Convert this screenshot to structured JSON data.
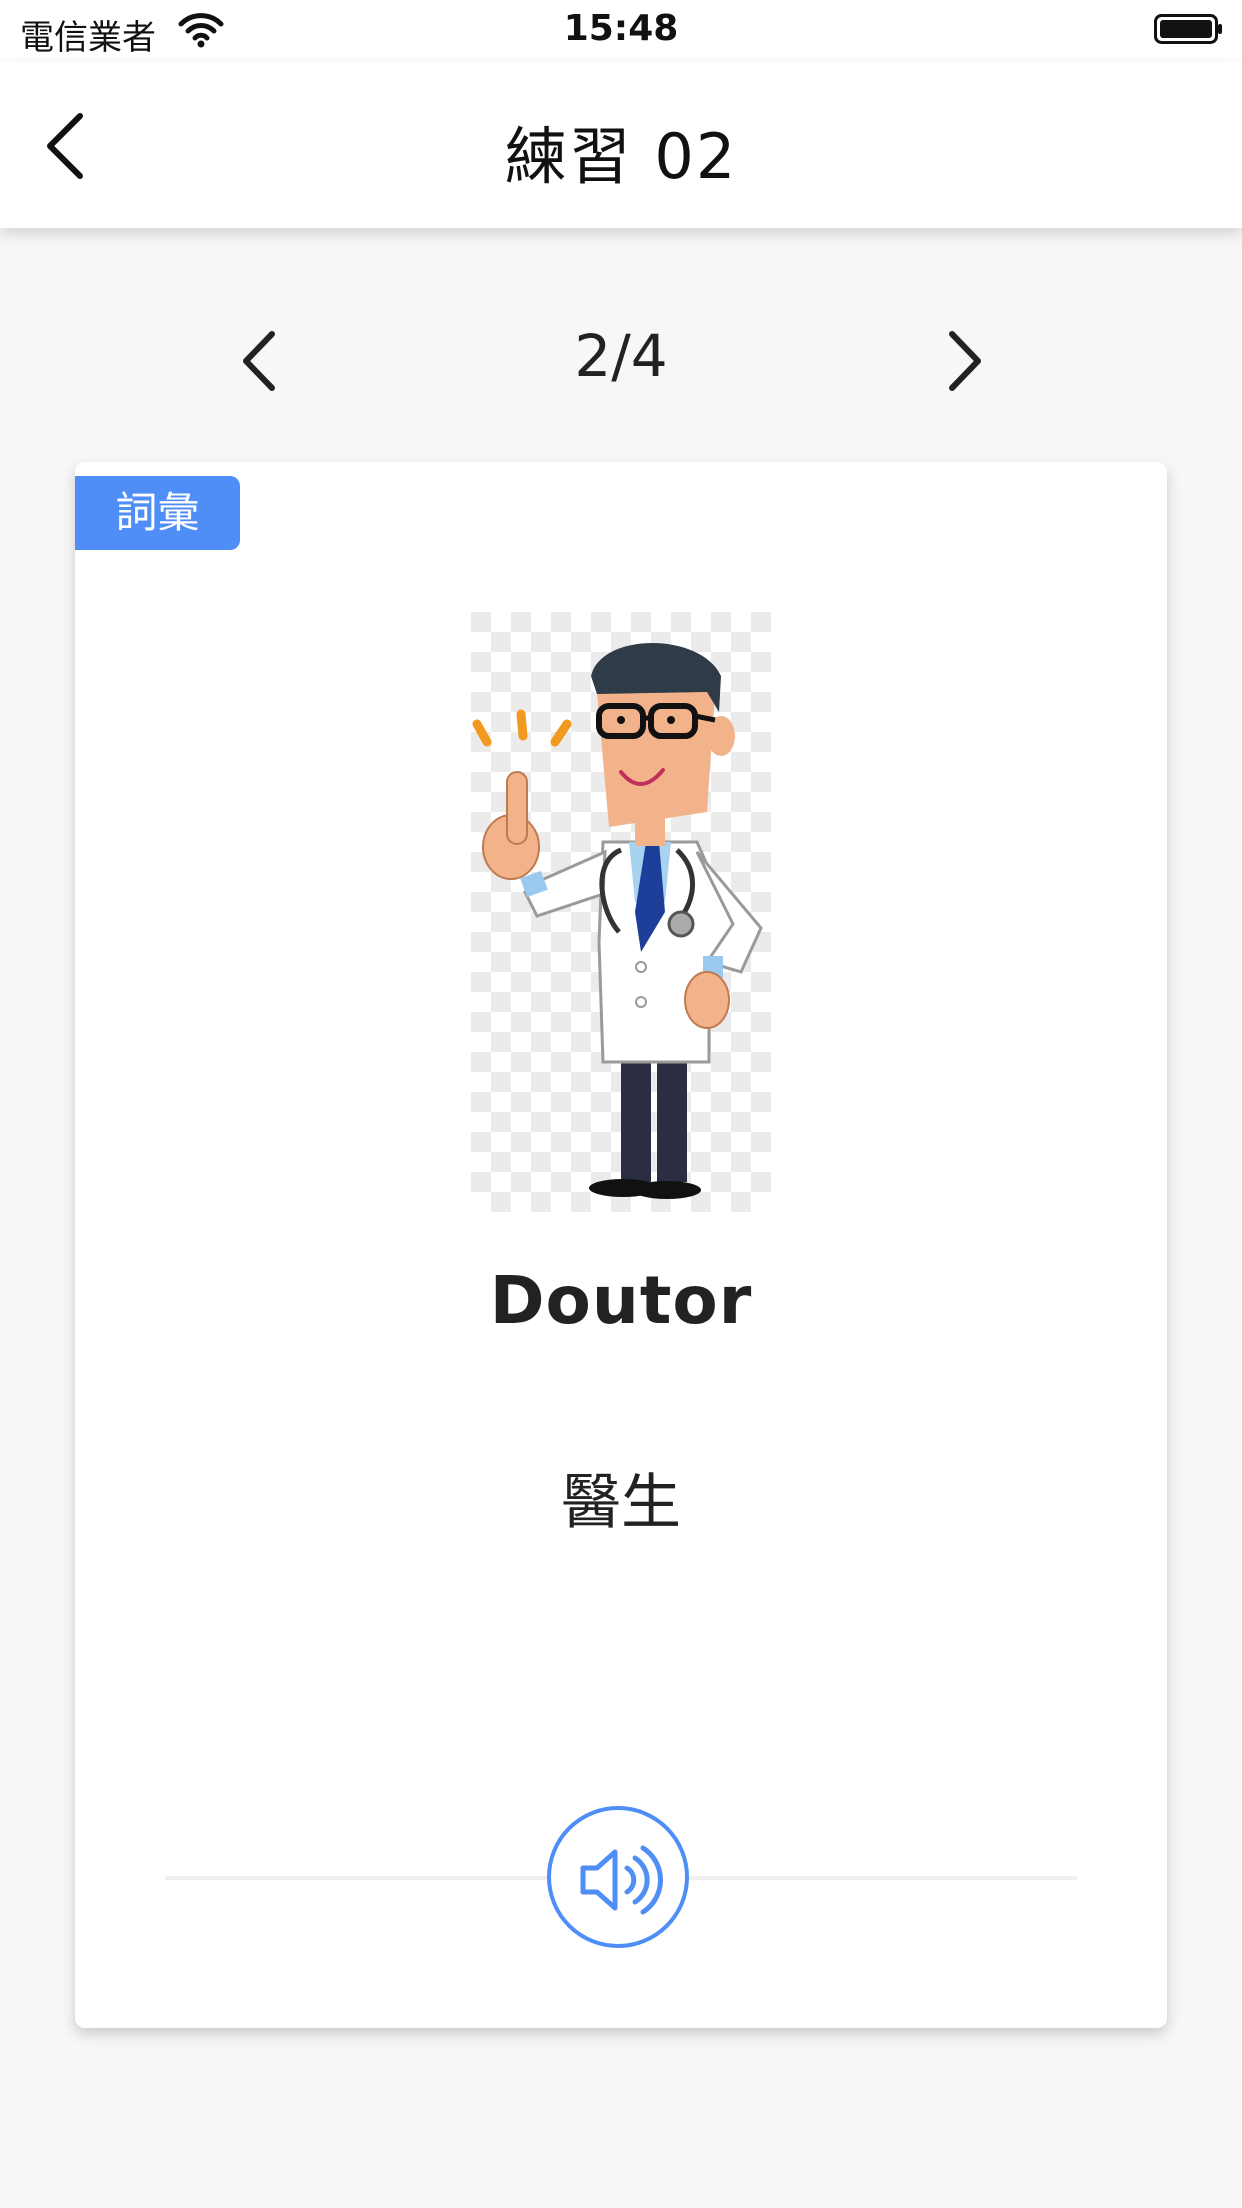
{
  "status_bar": {
    "carrier": "電信業者",
    "time": "15:48"
  },
  "nav": {
    "title": "練習 02",
    "back_icon": "chevron-left-icon"
  },
  "pager": {
    "counter": "2/4",
    "prev_icon": "chevron-left-icon",
    "next_icon": "chevron-right-icon"
  },
  "card": {
    "tag": "詞彙",
    "image": "doctor-illustration",
    "word": "Doutor",
    "translation": "醫生",
    "audio_icon": "speaker-icon"
  },
  "colors": {
    "accent": "#4f8ef7",
    "background": "#f7f7f7",
    "card": "#ffffff",
    "text": "#222222"
  }
}
